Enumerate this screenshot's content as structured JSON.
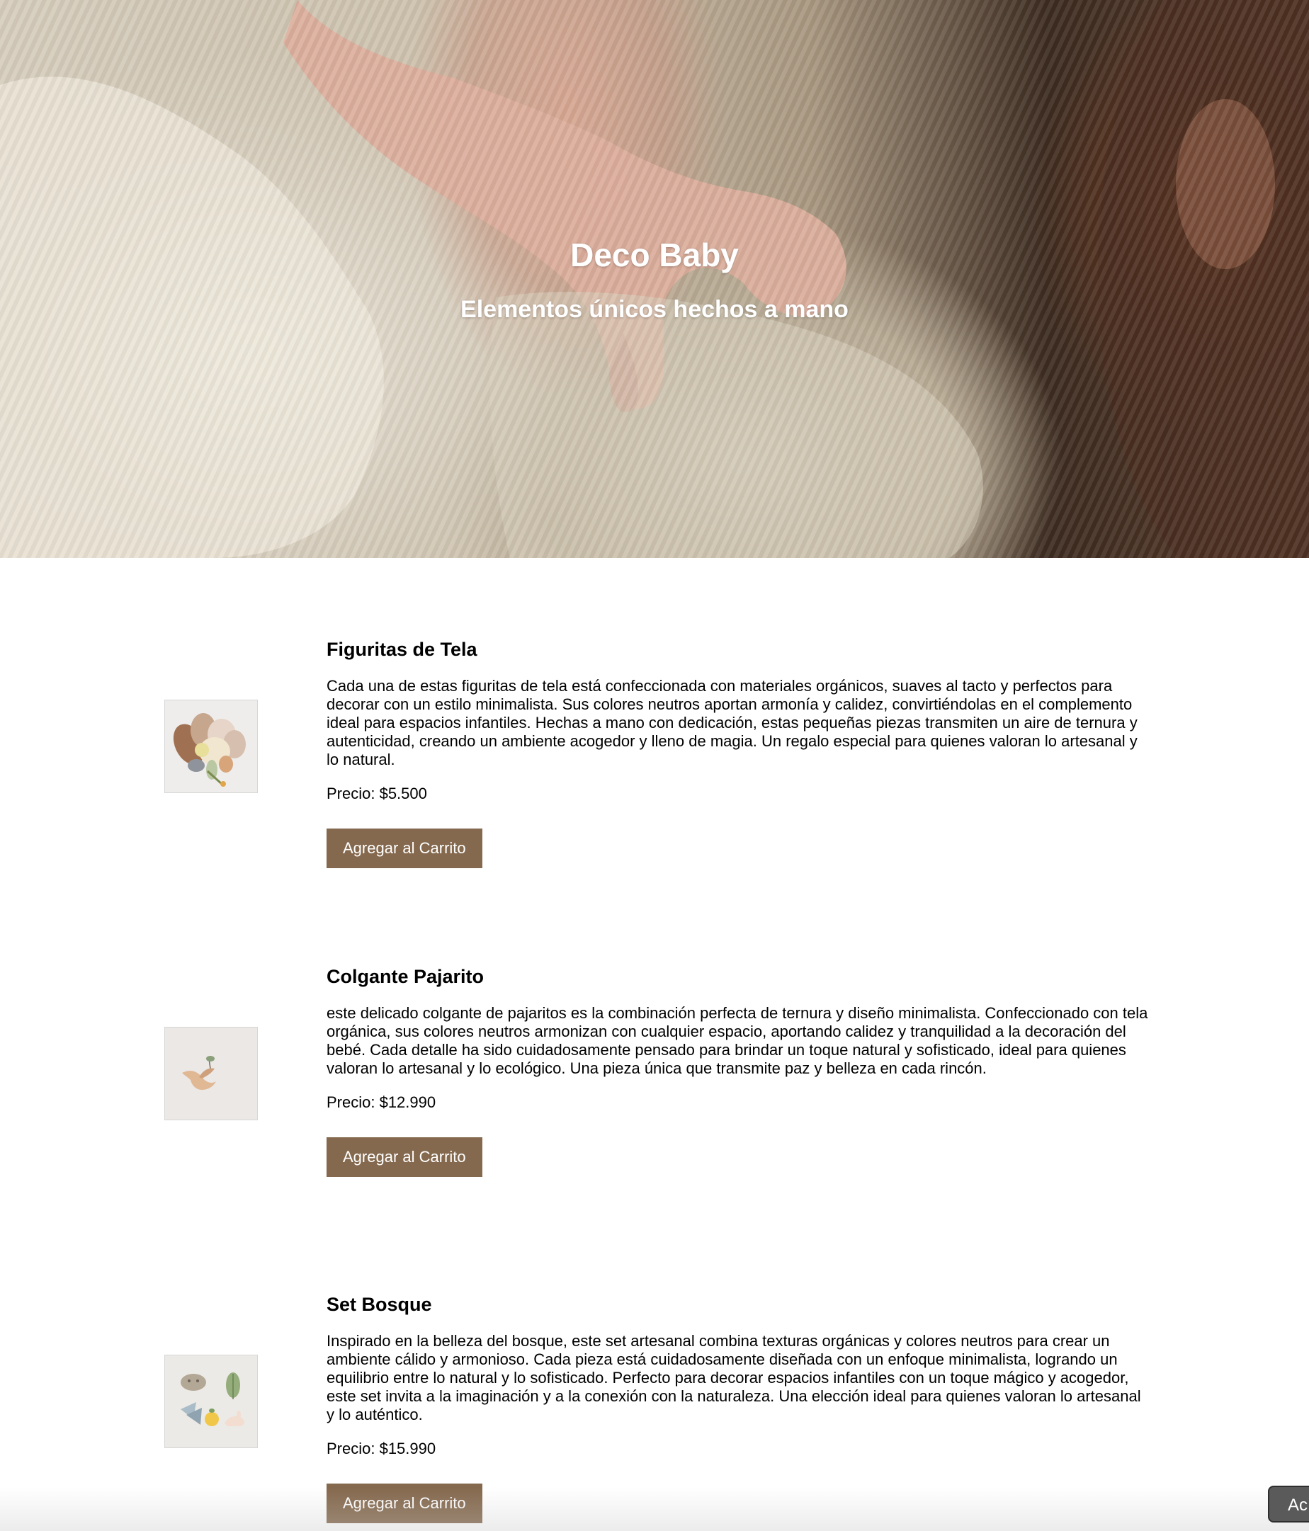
{
  "hero": {
    "title": "Deco Baby",
    "subtitle": "Elementos únicos hechos a mano"
  },
  "products": [
    {
      "name": "Figuritas de Tela",
      "description": "Cada una de estas figuritas de tela está confeccionada con materiales orgánicos, suaves al tacto y perfectos para decorar con un estilo minimalista. Sus colores neutros aportan armonía y calidez, convirtiéndolas en el complemento ideal para espacios infantiles. Hechas a mano con dedicación, estas pequeñas piezas transmiten un aire de ternura y autenticidad, creando un ambiente acogedor y lleno de magia. Un regalo especial para quienes valoran lo artesanal y lo natural.",
      "price": "Precio: $5.500",
      "button": "Agregar al Carrito"
    },
    {
      "name": "Colgante Pajarito",
      "description": "este delicado colgante de pajaritos es la combinación perfecta de ternura y diseño minimalista. Confeccionado con tela orgánica, sus colores neutros armonizan con cualquier espacio, aportando calidez y tranquilidad a la decoración del bebé. Cada detalle ha sido cuidadosamente pensado para brindar un toque natural y sofisticado, ideal para quienes valoran lo artesanal y lo ecológico. Una pieza única que transmite paz y belleza en cada rincón.",
      "price": "Precio: $12.990",
      "button": "Agregar al Carrito"
    },
    {
      "name": "Set Bosque",
      "description": "Inspirado en la belleza del bosque, este set artesanal combina texturas orgánicas y colores neutros para crear un ambiente cálido y armonioso. Cada pieza está cuidadosamente diseñada con un enfoque minimalista, logrando un equilibrio entre lo natural y lo sofisticado. Perfecto para decorar espacios infantiles con un toque mágico y acogedor, este set invita a la imaginación y a la conexión con la naturaleza. Una elección ideal para quienes valoran lo artesanal y lo auténtico.",
      "price": "Precio: $15.990",
      "button": "Agregar al Carrito"
    }
  ],
  "floating_button": {
    "label": "Ac"
  },
  "colors": {
    "button_bg": "#85694e",
    "button_text": "#ffffff",
    "hero_text": "#ffffff"
  }
}
